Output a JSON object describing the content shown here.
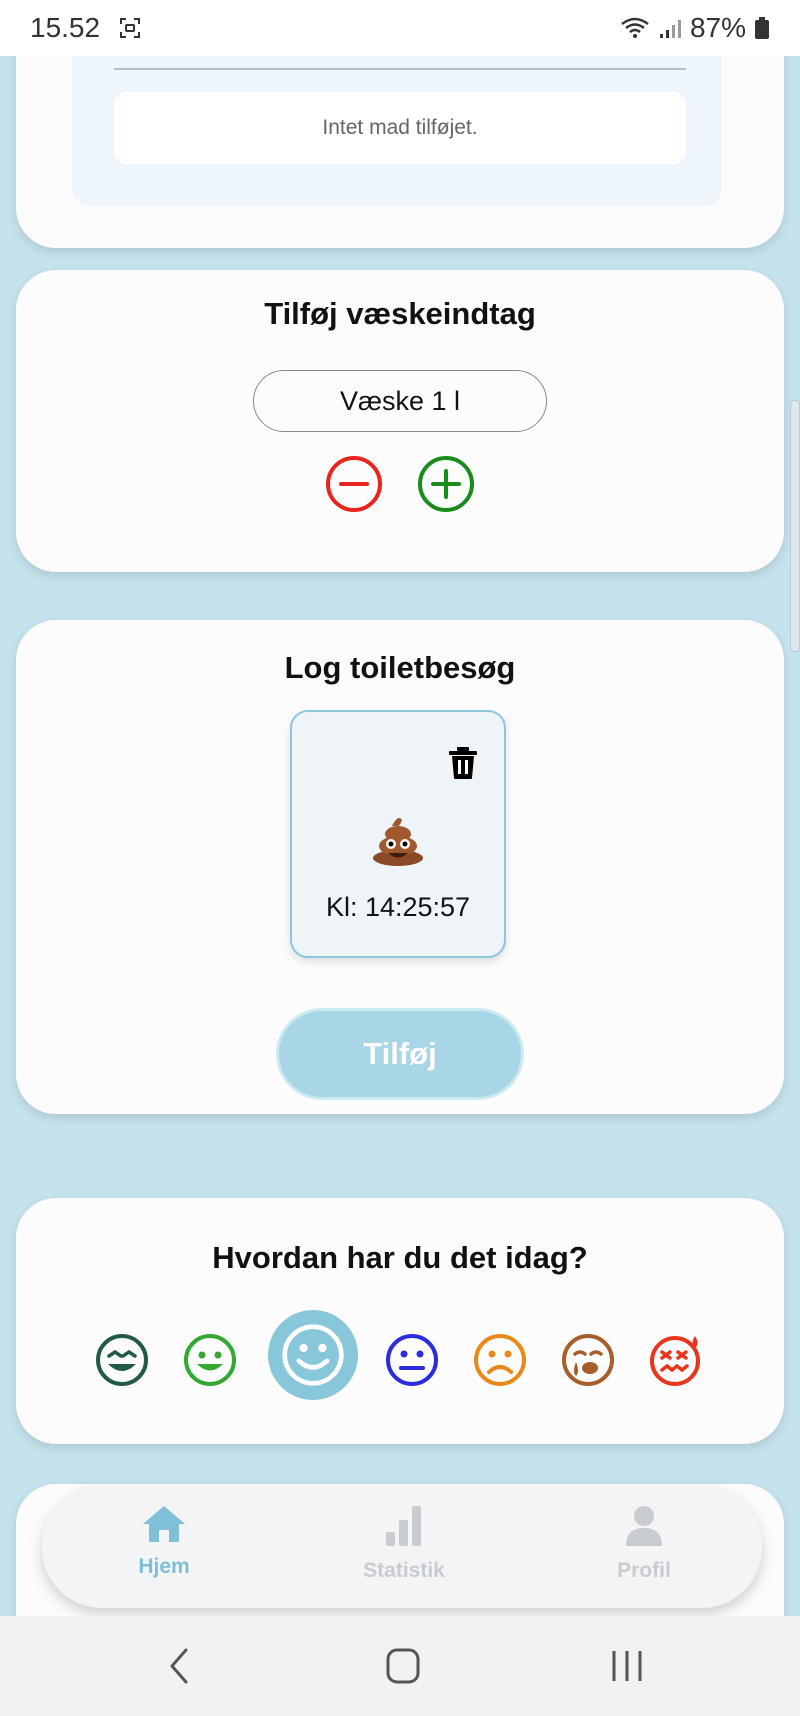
{
  "status_bar": {
    "time": "15.52",
    "battery": "87%"
  },
  "food_section": {
    "empty_text": "Intet mad tilføjet."
  },
  "liquid_section": {
    "title": "Tilføj væskeindtag",
    "value_text": "Væske 1 l",
    "colors": {
      "minus": "#e8241c",
      "plus": "#198c1c"
    }
  },
  "toilet_section": {
    "title": "Log toiletbesøg",
    "entries": [
      {
        "time_text": "Kl: 14:25:57",
        "icon": "poop-icon"
      }
    ],
    "add_label": "Tilføj"
  },
  "mood_section": {
    "title": "Hvordan har du det idag?",
    "moods": [
      {
        "icon": "grinning-face-icon",
        "color": "#215c42"
      },
      {
        "icon": "happy-face-icon",
        "color": "#33a833"
      },
      {
        "icon": "smiling-face-icon",
        "color": "#ffffff",
        "selected": true
      },
      {
        "icon": "neutral-face-icon",
        "color": "#2b2be0"
      },
      {
        "icon": "sad-face-icon",
        "color": "#e8891c"
      },
      {
        "icon": "crying-face-icon",
        "color": "#a85e2a"
      },
      {
        "icon": "sick-face-icon",
        "color": "#e8351c"
      }
    ]
  },
  "bottom_nav": {
    "items": [
      {
        "label": "Hjem",
        "icon": "home-icon",
        "active": true
      },
      {
        "label": "Statistik",
        "icon": "bar-chart-icon",
        "active": false
      },
      {
        "label": "Profil",
        "icon": "person-icon",
        "active": false
      }
    ],
    "colors": {
      "active": "#7fc0d8",
      "inactive": "#c8ccd0"
    }
  }
}
